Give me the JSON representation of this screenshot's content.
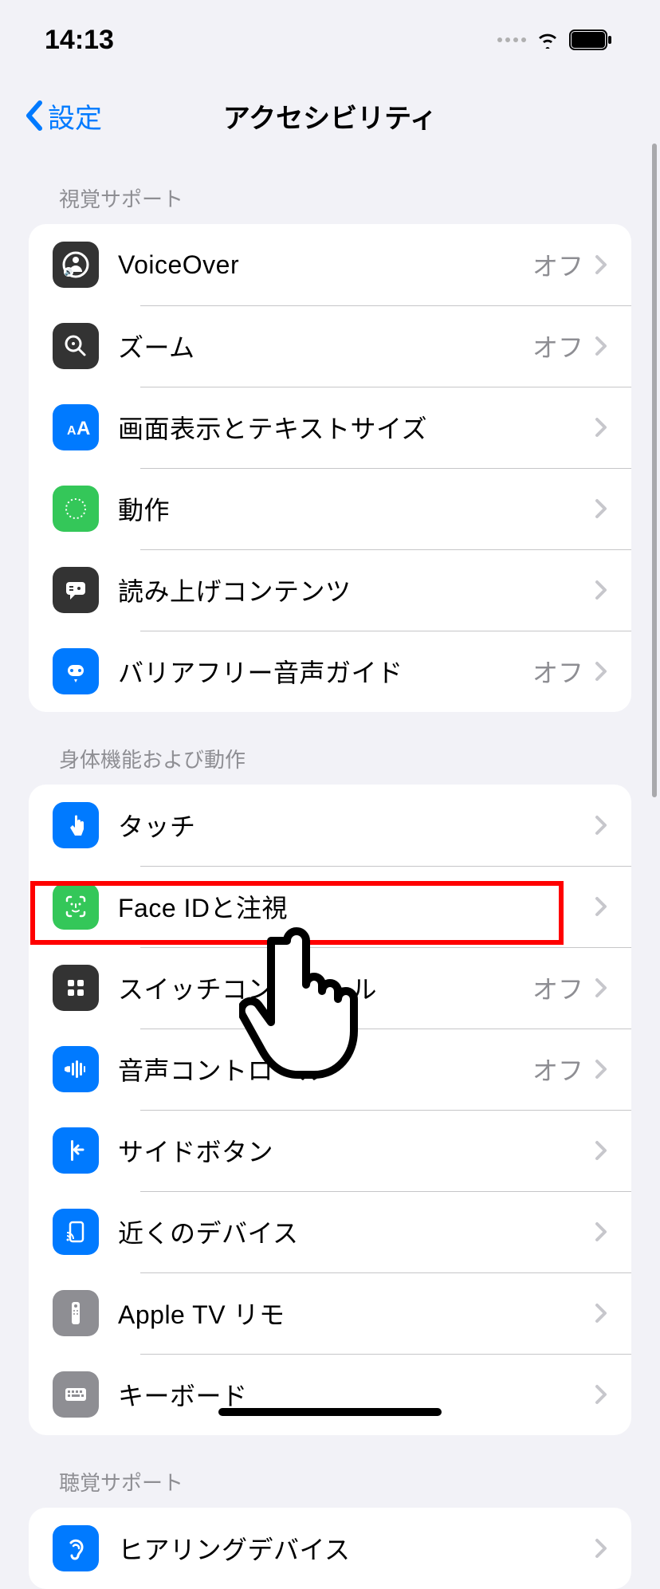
{
  "status": {
    "time": "14:13"
  },
  "nav": {
    "back": "設定",
    "title": "アクセシビリティ"
  },
  "sections": {
    "visual": {
      "header": "視覚サポート"
    },
    "physical": {
      "header": "身体機能および動作"
    },
    "hearing": {
      "header": "聴覚サポート"
    }
  },
  "rows": {
    "voiceover": {
      "label": "VoiceOver",
      "value": "オフ"
    },
    "zoom": {
      "label": "ズーム",
      "value": "オフ"
    },
    "display": {
      "label": "画面表示とテキストサイズ"
    },
    "motion": {
      "label": "動作"
    },
    "spoken": {
      "label": "読み上げコンテンツ"
    },
    "audio_desc": {
      "label": "バリアフリー音声ガイド",
      "value": "オフ"
    },
    "touch": {
      "label": "タッチ"
    },
    "faceid": {
      "label": "Face IDと注視"
    },
    "switch": {
      "label": "スイッチコントロール",
      "value": "オフ"
    },
    "voice_control": {
      "label": "音声コントロール",
      "value": "オフ"
    },
    "side_button": {
      "label": "サイドボタン"
    },
    "nearby": {
      "label": "近くのデバイス"
    },
    "appletv": {
      "label": "Apple TV リモ"
    },
    "keyboard": {
      "label": "キーボード"
    },
    "hearing": {
      "label": "ヒアリングデバイス"
    }
  }
}
